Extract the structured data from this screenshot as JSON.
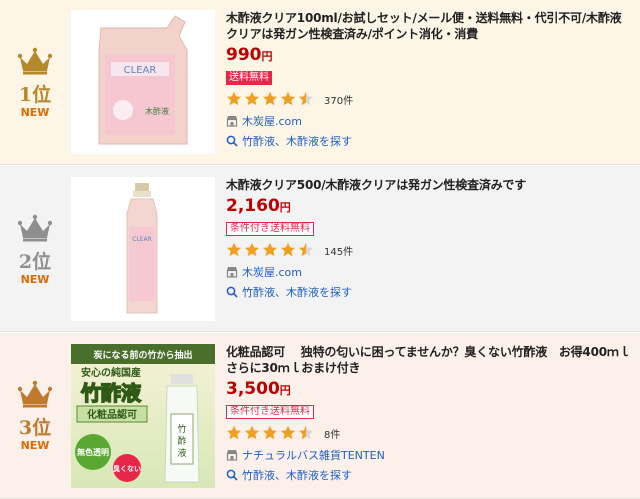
{
  "colors": {
    "gold": "#b5882b",
    "silver": "#8f8f8f",
    "bronze": "#c07a2f",
    "new": "#e06a00",
    "price": "#bf0000",
    "star": "#f0a020",
    "link": "#1e5ec8",
    "shipping": "#e8264a"
  },
  "items": [
    {
      "rank": "1位",
      "new": "NEW",
      "title": "木酢液クリア100ml/お試しセット/メール便・送料無料・代引不可/木酢液クリアは発ガン性検査済み/ポイント消化・消費",
      "price": "990",
      "yen": "円",
      "shipping": "送料無料",
      "rating": 4.5,
      "reviews": "370件",
      "shop": "木炭屋.com",
      "search": "竹酢液、木酢液を探す",
      "image_text": [
        "CLEAR",
        "木酢液"
      ]
    },
    {
      "rank": "2位",
      "new": "NEW",
      "title": "木酢液クリア500/木酢液クリアは発ガン性検査済みです",
      "price": "2,160",
      "yen": "円",
      "shipping": "条件付き送料無料",
      "rating": 4.5,
      "reviews": "145件",
      "shop": "木炭屋.com",
      "search": "竹酢液、木酢液を探す",
      "image_text": [
        "CLEAR"
      ]
    },
    {
      "rank": "3位",
      "new": "NEW",
      "title": "化粧品認可　 独特の匂いに困ってませんか？臭くない竹酢液　お得400ｍｌさらに30ｍｌおまけ付き",
      "price": "3,500",
      "yen": "円",
      "shipping": "条件付き送料無料",
      "rating": 4.5,
      "reviews": "8件",
      "shop": "ナチュラルバス雑貨TENTEN",
      "search": "竹酢液、木酢液を探す",
      "image_text": [
        "炭になる前の竹から抽出",
        "安心の純国産",
        "竹酢液",
        "化粧品認可",
        "無色透明",
        "臭くない"
      ]
    }
  ]
}
